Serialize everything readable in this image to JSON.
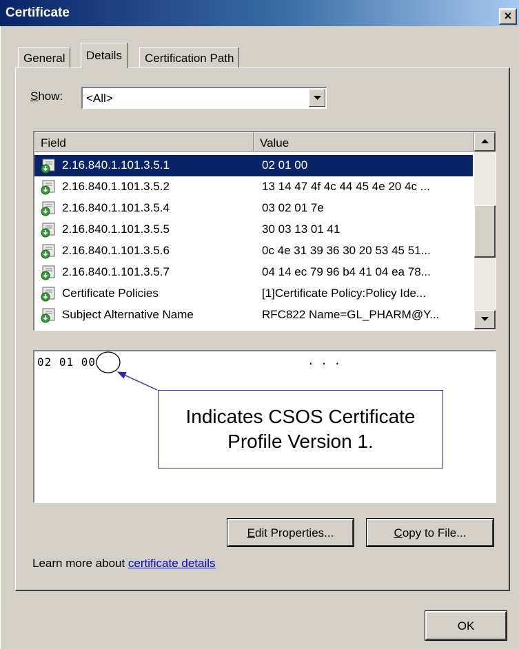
{
  "window": {
    "title": "Certificate",
    "close_glyph": "×"
  },
  "tabs": [
    {
      "label": "General",
      "active": false
    },
    {
      "label": "Details",
      "active": true
    },
    {
      "label": "Certification Path",
      "active": false
    }
  ],
  "show": {
    "label_first": "S",
    "label_rest": "how:",
    "value": "<All>"
  },
  "list": {
    "columns": [
      "Field",
      "Value"
    ],
    "rows": [
      {
        "field": "2.16.840.1.101.3.5.1",
        "value": "02 01 00",
        "selected": true
      },
      {
        "field": "2.16.840.1.101.3.5.2",
        "value": "13 14 47 4f 4c 44 45 4e 20 4c ..."
      },
      {
        "field": "2.16.840.1.101.3.5.4",
        "value": "03 02 01 7e"
      },
      {
        "field": "2.16.840.1.101.3.5.5",
        "value": "30 03 13 01 41"
      },
      {
        "field": "2.16.840.1.101.3.5.6",
        "value": "0c 4e 31 39 36 30 20 53 45 51..."
      },
      {
        "field": "2.16.840.1.101.3.5.7",
        "value": "04 14 ec 79 96 b4 41 04 ea 78..."
      },
      {
        "field": "Certificate Policies",
        "value": "[1]Certificate Policy:Policy Ide..."
      },
      {
        "field": "Subject Alternative Name",
        "value": "RFC822 Name=GL_PHARM@Y..."
      }
    ]
  },
  "detail": {
    "hex_prefix": "02 01 ",
    "hex_highlight": "00",
    "dots": ". . ."
  },
  "callout": {
    "line1": "Indicates CSOS Certificate",
    "line2": "Profile Version 1."
  },
  "buttons": {
    "edit_first": "E",
    "edit_rest": "dit Properties...",
    "copy_first": "C",
    "copy_rest": "opy to File...",
    "ok": "OK"
  },
  "learn_more": {
    "prefix": "Learn more about ",
    "link": "certificate details"
  },
  "icons": {
    "row_icon": "certificate-extension-icon",
    "dropdown": "chevron-down-icon"
  },
  "colors": {
    "selection": "#0a246a",
    "callout_border": "#2a2ab0",
    "link": "#0000cc"
  }
}
